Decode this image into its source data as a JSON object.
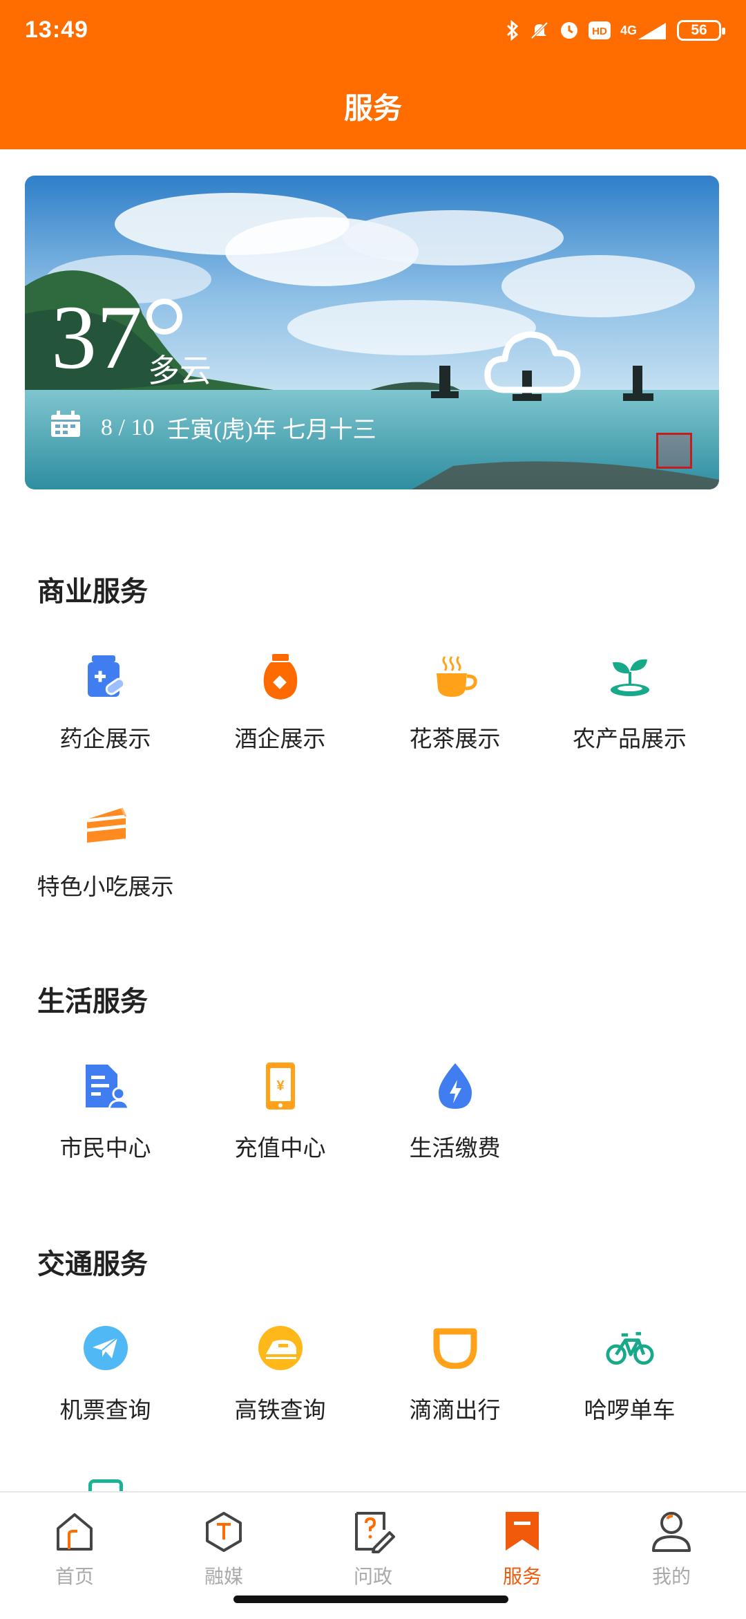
{
  "status_bar": {
    "time": "13:49",
    "network": "4G",
    "battery": "56",
    "icons": [
      "bluetooth-icon",
      "mute-icon",
      "alarm-icon",
      "hd-icon",
      "signal-icon",
      "battery-icon"
    ]
  },
  "header": {
    "title": "服务"
  },
  "weather": {
    "temperature": "37",
    "condition": "多云",
    "date": "8 / 10",
    "lunar": "壬寅(虎)年 七月十三"
  },
  "sections": {
    "business": {
      "title": "商业服务",
      "items": [
        {
          "label": "药企展示",
          "icon": "medicine-icon",
          "color": "#3f7df0"
        },
        {
          "label": "酒企展示",
          "icon": "wine-jar-icon",
          "color": "#ff6a00"
        },
        {
          "label": "花茶展示",
          "icon": "tea-cup-icon",
          "color": "#ffa21a"
        },
        {
          "label": "农产品展示",
          "icon": "sprout-icon",
          "color": "#17a98a"
        },
        {
          "label": "特色小吃展示",
          "icon": "cake-icon",
          "color": "#ff8a1f"
        }
      ]
    },
    "life": {
      "title": "生活服务",
      "items": [
        {
          "label": "市民中心",
          "icon": "citizen-card-icon",
          "color": "#3f7df0"
        },
        {
          "label": "充值中心",
          "icon": "phone-recharge-icon",
          "color": "#ffa21a"
        },
        {
          "label": "生活缴费",
          "icon": "utility-drop-icon",
          "color": "#3f7df0"
        }
      ]
    },
    "transport": {
      "title": "交通服务",
      "items": [
        {
          "label": "机票查询",
          "icon": "plane-ticket-icon",
          "color": "#4fb8f5"
        },
        {
          "label": "高铁查询",
          "icon": "high-speed-rail-icon",
          "color": "#ffb81a"
        },
        {
          "label": "滴滴出行",
          "icon": "didi-icon",
          "color": "#ffa21a"
        },
        {
          "label": "哈啰单车",
          "icon": "bicycle-icon",
          "color": "#17a98a"
        }
      ]
    }
  },
  "bottom_nav": {
    "items": [
      {
        "label": "首页",
        "icon": "home-icon"
      },
      {
        "label": "融媒",
        "icon": "media-icon"
      },
      {
        "label": "问政",
        "icon": "inquiry-icon"
      },
      {
        "label": "服务",
        "icon": "service-bookmark-icon",
        "active": true
      },
      {
        "label": "我的",
        "icon": "profile-icon"
      }
    ],
    "active_color": "#f05a0a",
    "inactive_color": "#aaaaaa"
  },
  "colors": {
    "brand": "#ff6c00"
  }
}
